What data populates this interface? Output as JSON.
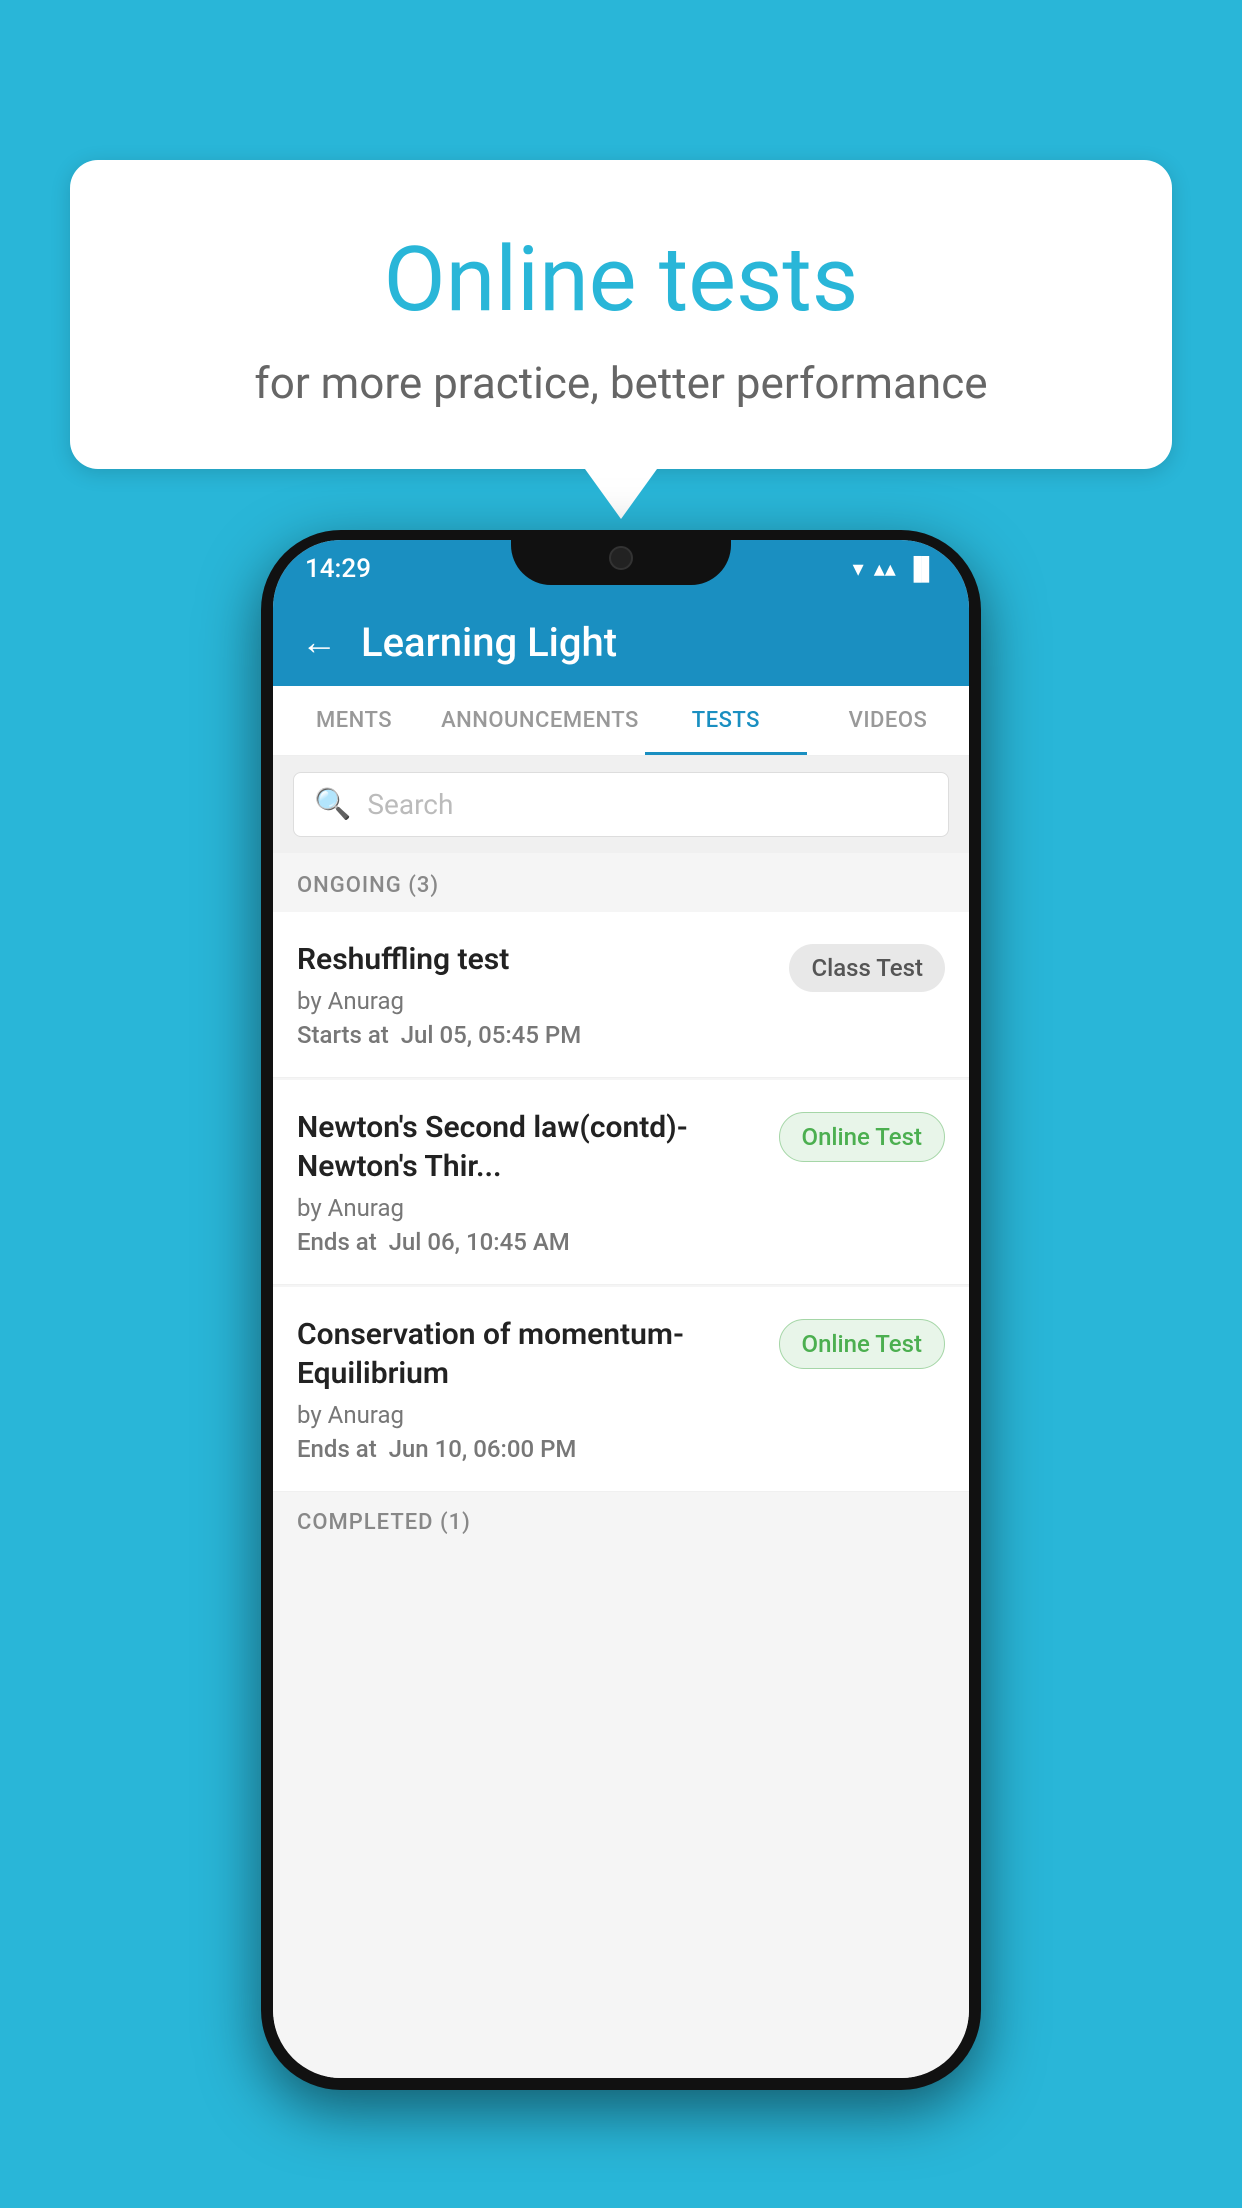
{
  "background_color": "#29b6d8",
  "speech_bubble": {
    "title": "Online tests",
    "subtitle": "for more practice, better performance"
  },
  "phone": {
    "status_bar": {
      "time": "14:29",
      "wifi": "▼",
      "signal": "▲",
      "battery": "▐"
    },
    "header": {
      "back_label": "←",
      "title": "Learning Light"
    },
    "tabs": [
      {
        "label": "MENTS",
        "active": false
      },
      {
        "label": "ANNOUNCEMENTS",
        "active": false
      },
      {
        "label": "TESTS",
        "active": true
      },
      {
        "label": "VIDEOS",
        "active": false
      }
    ],
    "search": {
      "placeholder": "Search"
    },
    "sections": [
      {
        "header": "ONGOING (3)",
        "items": [
          {
            "title": "Reshuffling test",
            "author": "by Anurag",
            "date_label": "Starts at",
            "date": "Jul 05, 05:45 PM",
            "badge": "Class Test",
            "badge_type": "class"
          },
          {
            "title": "Newton's Second law(contd)-Newton's Thir...",
            "author": "by Anurag",
            "date_label": "Ends at",
            "date": "Jul 06, 10:45 AM",
            "badge": "Online Test",
            "badge_type": "online"
          },
          {
            "title": "Conservation of momentum-Equilibrium",
            "author": "by Anurag",
            "date_label": "Ends at",
            "date": "Jun 10, 06:00 PM",
            "badge": "Online Test",
            "badge_type": "online"
          }
        ]
      },
      {
        "header": "COMPLETED (1)",
        "items": []
      }
    ]
  }
}
